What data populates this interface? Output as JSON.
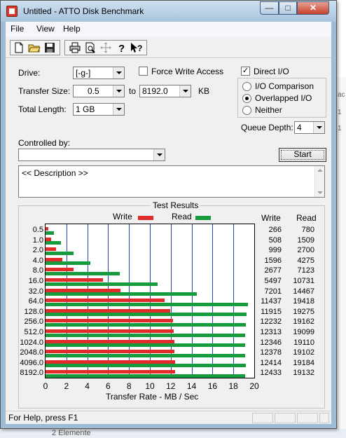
{
  "window": {
    "title": "Untitled - ATTO Disk Benchmark"
  },
  "menu": [
    "File",
    "View",
    "Help"
  ],
  "toolbar_icons": [
    "new-file-icon",
    "open-folder-icon",
    "save-icon",
    "print-icon",
    "print-preview-icon",
    "move-icon",
    "help-icon",
    "context-help-icon"
  ],
  "form": {
    "drive_label": "Drive:",
    "drive_value": "[-g-]",
    "force_write_label": "Force Write Access",
    "force_write_checked": false,
    "direct_io_label": "Direct I/O",
    "direct_io_checked": true,
    "transfer_size_label": "Transfer Size:",
    "transfer_from": "0.5",
    "to_label": "to",
    "transfer_to": "8192.0",
    "kb_label": "KB",
    "total_length_label": "Total Length:",
    "total_length_value": "1 GB",
    "io_options": [
      "I/O Comparison",
      "Overlapped I/O",
      "Neither"
    ],
    "io_selected": "Overlapped I/O",
    "queue_depth_label": "Queue Depth:",
    "queue_depth_value": "4",
    "controlled_by_label": "Controlled by:",
    "controlled_by_value": "",
    "start_label": "Start",
    "description": "<< Description >>"
  },
  "results": {
    "title": "Test Results",
    "legend_write": "Write",
    "legend_read": "Read",
    "col_write": "Write",
    "col_read": "Read",
    "xlabel": "Transfer Rate - MB / Sec",
    "write_values_text": [
      "266",
      "508",
      "999",
      "1596",
      "2677",
      "5497",
      "7201",
      "11437",
      "11915",
      "12232",
      "12313",
      "12346",
      "12378",
      "12414",
      "12433"
    ],
    "read_values_text": [
      "780",
      "1509",
      "2700",
      "4275",
      "7123",
      "10731",
      "14467",
      "19418",
      "19275",
      "19162",
      "19099",
      "19110",
      "19102",
      "19184",
      "19132"
    ]
  },
  "chart_data": {
    "type": "bar",
    "orientation": "horizontal",
    "xlabel": "Transfer Rate - MB / Sec",
    "xlim": [
      0,
      20
    ],
    "xticks": [
      "0",
      "2",
      "4",
      "6",
      "8",
      "10",
      "12",
      "14",
      "16",
      "18",
      "20"
    ],
    "categories": [
      "0.5",
      "1.0",
      "2.0",
      "4.0",
      "8.0",
      "16.0",
      "32.0",
      "64.0",
      "128.0",
      "256.0",
      "512.0",
      "1024.0",
      "2048.0",
      "4096.0",
      "8192.0"
    ],
    "series": [
      {
        "name": "Write",
        "color": "#e32a2a",
        "values": [
          266,
          508,
          999,
          1596,
          2677,
          5497,
          7201,
          11437,
          11915,
          12232,
          12313,
          12346,
          12378,
          12414,
          12433
        ]
      },
      {
        "name": "Read",
        "color": "#159a3c",
        "values": [
          780,
          1509,
          2700,
          4275,
          7123,
          10731,
          14467,
          19418,
          19275,
          19162,
          19099,
          19110,
          19102,
          19184,
          19132
        ]
      }
    ],
    "grid": true,
    "legend": "top"
  },
  "status": {
    "text": "For Help, press F1"
  },
  "background": {
    "fragments": [
      "ac",
      "1",
      "1"
    ],
    "bottom_text": "2 Elemente"
  }
}
